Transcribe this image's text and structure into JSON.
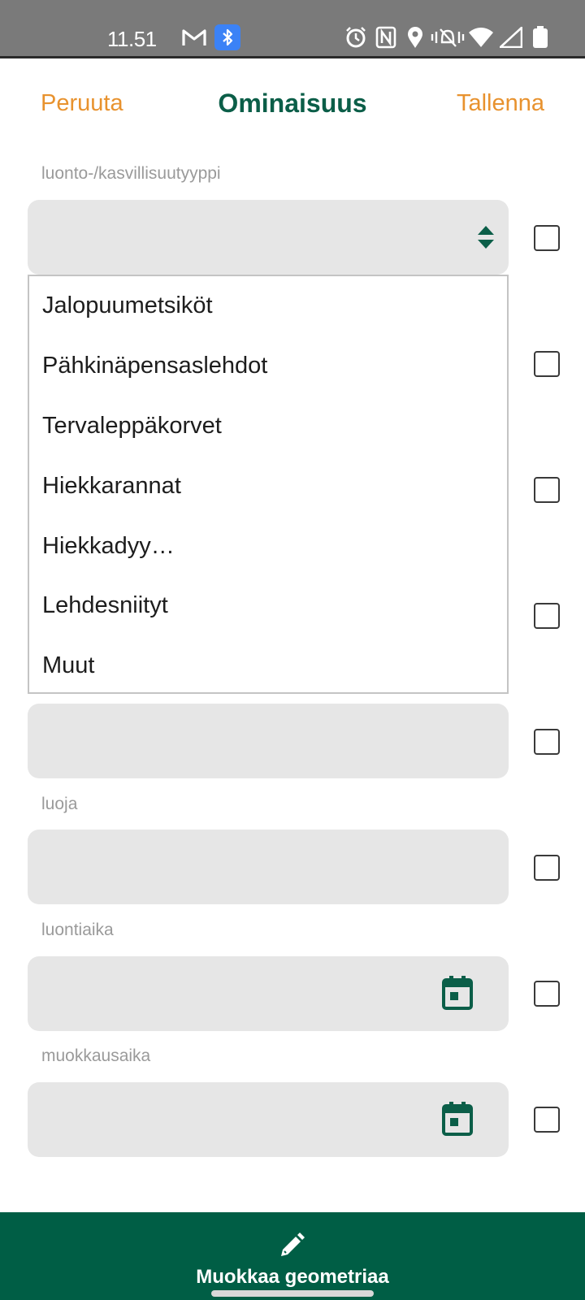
{
  "status_bar": {
    "time": "11.51",
    "icons": [
      "gmail-icon",
      "bluetooth-icon",
      "alarm-icon",
      "nfc-icon",
      "location-icon",
      "vibrate-icon",
      "wifi-icon",
      "signal-icon",
      "battery-icon"
    ]
  },
  "header": {
    "cancel_label": "Peruuta",
    "title": "Ominaisuus",
    "save_label": "Tallenna"
  },
  "form": {
    "type_field": {
      "label": "luonto-/kasvillisuutyyppi",
      "value": ""
    },
    "creator_field": {
      "label": "luoja",
      "value": ""
    },
    "created_field": {
      "label": "luontiaika",
      "value": ""
    },
    "modified_field": {
      "label": "muokkausaika",
      "value": ""
    }
  },
  "dropdown": {
    "options": [
      "Jalopuumetsiköt",
      "Pähkinäpensaslehdot",
      "Tervaleppäkorvet",
      "Hiekkarannat",
      "Hiekkadyy…",
      "Lehdesniityt",
      "Muut"
    ]
  },
  "bottom_bar": {
    "label": "Muokkaa geometriaa"
  },
  "colors": {
    "accent_orange": "#e8922e",
    "brand_green": "#005e45",
    "field_bg": "#e6e6e6",
    "status_bar_bg": "#7a7a7a"
  }
}
